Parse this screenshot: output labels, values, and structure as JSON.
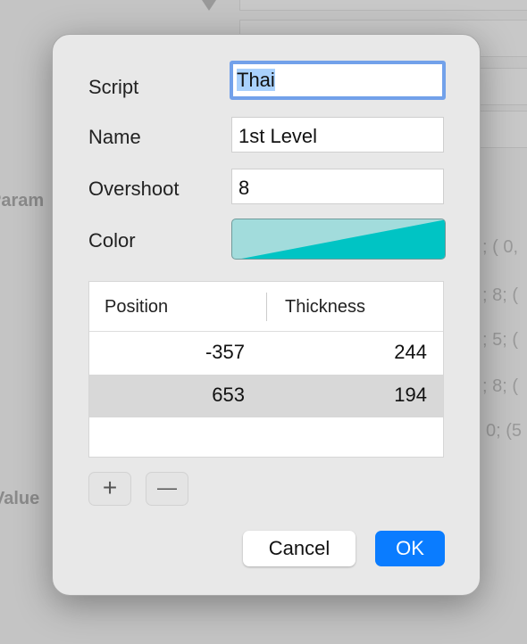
{
  "background": {
    "labels": [
      "Param",
      "Value"
    ],
    "values": [
      "; (  0,",
      "; 8; (",
      "; 5; (",
      "; 8; (",
      "0; (5"
    ]
  },
  "dialog": {
    "fields": [
      {
        "label": "Script",
        "value": "Thai"
      },
      {
        "label": "Name",
        "value": "1st Level"
      },
      {
        "label": "Overshoot",
        "value": "8"
      }
    ],
    "color": {
      "label": "Color",
      "light": "#a2dcdc",
      "dark": "#00c4c4"
    },
    "table": {
      "headers": [
        "Position",
        "Thickness"
      ],
      "rows": [
        [
          "-357",
          "244"
        ],
        [
          "653",
          "194"
        ]
      ],
      "selected_row": 1
    },
    "add_label": "+",
    "remove_label": "—",
    "cancel_label": "Cancel",
    "ok_label": "OK",
    "accent": "#0a7cff"
  }
}
